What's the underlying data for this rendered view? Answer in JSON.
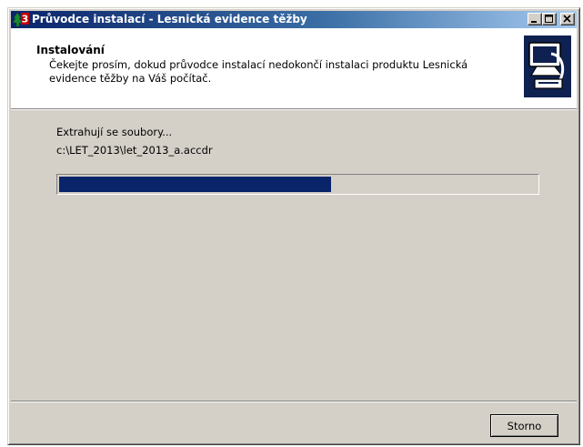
{
  "window": {
    "title": "Průvodce instalací - Lesnická evidence těžby",
    "app_icon": "tree-3-icon",
    "title_gradient_start": "#0a246a",
    "title_gradient_end": "#a6caf0"
  },
  "header": {
    "title": "Instalování",
    "description": "Čekejte prosím, dokud průvodce instalací nedokončí instalaci produktu Lesnická evidence těžby na Váš počítač.",
    "image": "computer-install-icon"
  },
  "content": {
    "status": "Extrahují se soubory...",
    "current_file": "c:\\LET_2013\\let_2013_a.accdr",
    "progress_fraction": 0.57,
    "progress_color": "#0a246a"
  },
  "footer": {
    "cancel_label": "Storno"
  }
}
